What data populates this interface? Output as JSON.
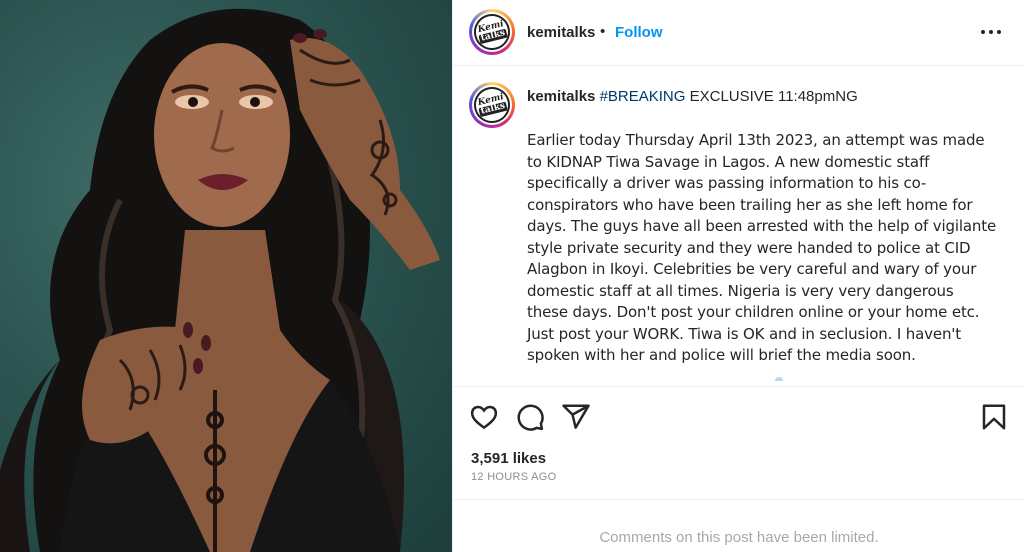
{
  "header": {
    "avatar_text_top": "Kemi",
    "avatar_text_bottom": "talks",
    "username": "kemitalks",
    "separator": "•",
    "follow_label": "Follow",
    "more_icon": "more-horizontal-icon"
  },
  "caption": {
    "username": "kemitalks",
    "hashtag": "#BREAKING",
    "headline": "EXCLUSIVE 11:48pmNG",
    "body": "Earlier today Thursday April 13th 2023, an attempt was made to KIDNAP Tiwa Savage in Lagos. A new domestic staff specifically a driver was passing information to his co-conspirators who have been trailing her as she left home for days. The guys have all been arrested with the help of vigilante style private security and they were handed to police at CID Alagbon in Ikoyi. Celebrities be very careful and wary of your domestic staff at all times. Nigeria is very very dangerous these days. Don't post your children online or your home etc. Just post your WORK. Tiwa is OK and in seclusion. I haven't spoken with her and police will brief the media soon."
  },
  "actions": {
    "like_icon": "heart-icon",
    "comment_icon": "comment-icon",
    "share_icon": "send-icon",
    "save_icon": "bookmark-icon"
  },
  "stats": {
    "likes": "3,591 likes",
    "time": "12 HOURS AGO"
  },
  "footer": {
    "comments_limited": "Comments on this post have been limited."
  },
  "colors": {
    "follow": "#0095f6",
    "hashtag": "#00376b",
    "photo_background": "#2b5450"
  }
}
